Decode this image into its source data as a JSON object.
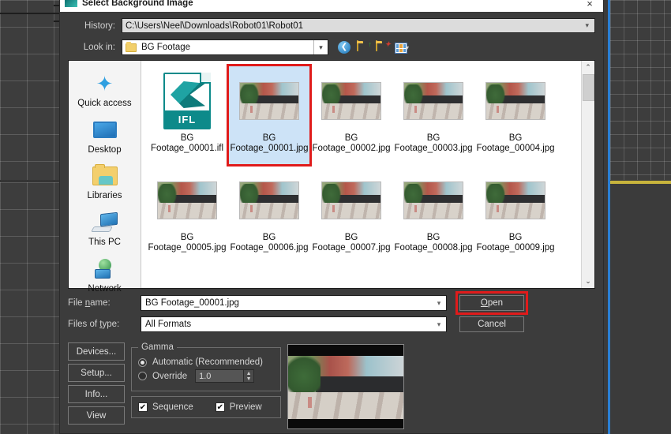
{
  "dialog": {
    "title": "Select Background Image",
    "close_label": "×",
    "history_label": "History:",
    "history_value": "C:\\Users\\Neel\\Downloads\\Robot01\\Robot01",
    "lookin_label": "Look in:",
    "lookin_value": "BG Footage"
  },
  "toolbar": {
    "back_glyph": "❮",
    "up_folder": "up-one-level",
    "new_folder": "create-new-folder",
    "views": "change-view"
  },
  "places": [
    {
      "label": "Quick access",
      "icon": "star-icon"
    },
    {
      "label": "Desktop",
      "icon": "desktop-icon"
    },
    {
      "label": "Libraries",
      "icon": "libraries-folder-icon"
    },
    {
      "label": "This PC",
      "icon": "this-pc-icon"
    },
    {
      "label": "Network",
      "icon": "network-icon"
    }
  ],
  "files": [
    {
      "line1": "BG",
      "line2": "Footage_00001.ifl",
      "type": "ifl",
      "badge": "IFL",
      "selected": false,
      "outlined": false
    },
    {
      "line1": "BG",
      "line2": "Footage_00001.jpg",
      "type": "jpg",
      "badge": "",
      "selected": true,
      "outlined": true
    },
    {
      "line1": "BG",
      "line2": "Footage_00002.jpg",
      "type": "jpg",
      "badge": "",
      "selected": false,
      "outlined": false
    },
    {
      "line1": "BG",
      "line2": "Footage_00003.jpg",
      "type": "jpg",
      "badge": "",
      "selected": false,
      "outlined": false
    },
    {
      "line1": "BG",
      "line2": "Footage_00004.jpg",
      "type": "jpg",
      "badge": "",
      "selected": false,
      "outlined": false
    },
    {
      "line1": "BG",
      "line2": "Footage_00005.jpg",
      "type": "jpg",
      "badge": "",
      "selected": false,
      "outlined": false
    },
    {
      "line1": "BG",
      "line2": "Footage_00006.jpg",
      "type": "jpg",
      "badge": "",
      "selected": false,
      "outlined": false
    },
    {
      "line1": "BG",
      "line2": "Footage_00007.jpg",
      "type": "jpg",
      "badge": "",
      "selected": false,
      "outlined": false
    },
    {
      "line1": "BG",
      "line2": "Footage_00008.jpg",
      "type": "jpg",
      "badge": "",
      "selected": false,
      "outlined": false
    },
    {
      "line1": "BG",
      "line2": "Footage_00009.jpg",
      "type": "jpg",
      "badge": "",
      "selected": false,
      "outlined": false
    }
  ],
  "form": {
    "filename_label_pre": "File ",
    "filename_label_u": "n",
    "filename_label_post": "ame:",
    "filename_value": "BG Footage_00001.jpg",
    "filetype_label_pre": "Files of ",
    "filetype_label_u": "t",
    "filetype_label_post": "ype:",
    "filetype_value": "All Formats",
    "open_pre": "",
    "open_u": "O",
    "open_post": "pen",
    "cancel_label": "Cancel"
  },
  "side_buttons": [
    {
      "label": "Devices..."
    },
    {
      "label": "Setup..."
    },
    {
      "label": "Info..."
    },
    {
      "label": "View"
    }
  ],
  "gamma": {
    "legend": "Gamma",
    "automatic_label": "Automatic (Recommended)",
    "automatic_selected": true,
    "override_label": "Override",
    "override_selected": false,
    "override_value": "1.0",
    "spin_up": "▲",
    "spin_down": "▼"
  },
  "options": {
    "sequence_label": "Sequence",
    "sequence_checked": true,
    "preview_label": "Preview",
    "preview_checked": true,
    "check_glyph": "✔"
  },
  "scrollbar": {
    "up_glyph": "⌃",
    "down_glyph": "⌄"
  },
  "colors": {
    "dialog_bg": "#3c3c3c",
    "highlight_red": "#e01b1b",
    "selection_blue": "#cde3f7",
    "viewport_blue": "#2a7fd4",
    "gizmo_yellow": "#c8b43c"
  }
}
